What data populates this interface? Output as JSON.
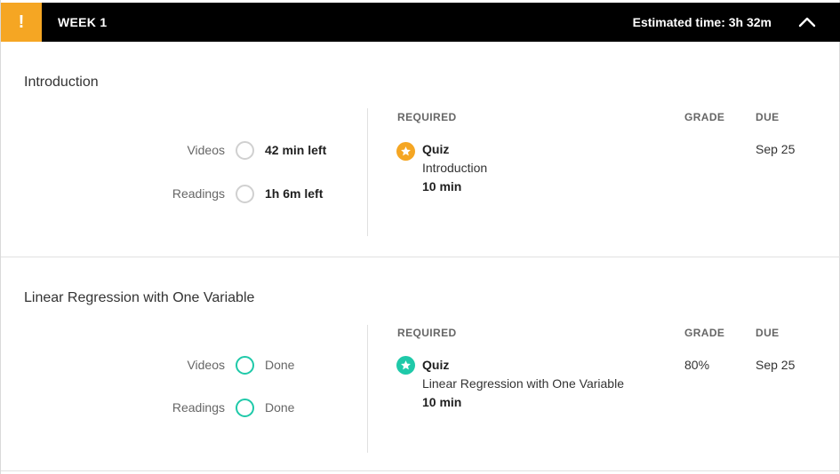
{
  "header": {
    "alert_symbol": "!",
    "week_title": "WEEK 1",
    "estimated_time": "Estimated time: 3h 32m",
    "collapse_icon": "chevron-up-icon",
    "accent_color": "#f5a623"
  },
  "modules": [
    {
      "title": "Introduction",
      "progress": [
        {
          "label": "Videos",
          "status": "42 min left",
          "done": false
        },
        {
          "label": "Readings",
          "status": "1h 6m left",
          "done": false
        }
      ],
      "columns": {
        "required": "REQUIRED",
        "grade": "GRADE",
        "due": "DUE"
      },
      "item": {
        "icon": "star-badge-icon",
        "icon_color": "#f5a623",
        "type": "Quiz",
        "name": "Introduction",
        "time": "10 min",
        "grade": "",
        "due": "Sep 25"
      }
    },
    {
      "title": "Linear Regression with One Variable",
      "progress": [
        {
          "label": "Videos",
          "status": "Done",
          "done": true
        },
        {
          "label": "Readings",
          "status": "Done",
          "done": true
        }
      ],
      "columns": {
        "required": "REQUIRED",
        "grade": "GRADE",
        "due": "DUE"
      },
      "item": {
        "icon": "star-badge-icon",
        "icon_color": "#1fc9a9",
        "type": "Quiz",
        "name": "Linear Regression with One Variable",
        "time": "10 min",
        "grade": "80%",
        "due": "Sep 25"
      }
    }
  ]
}
